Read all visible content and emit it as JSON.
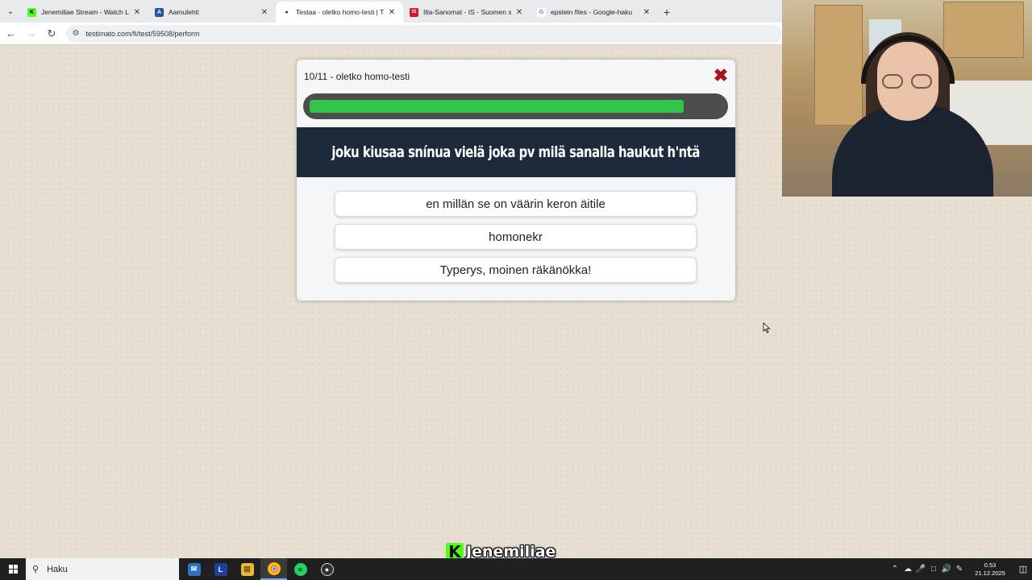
{
  "browser": {
    "tabs": [
      {
        "title": "Jenemiliae Stream - Watch Live",
        "favicon": "kick-icon",
        "color": "#53fc18",
        "active": false
      },
      {
        "title": "Aamulehti",
        "favicon": "aamulehti-icon",
        "color": "#2a4fa3",
        "active": false
      },
      {
        "title": "Testaa - oletko homo-testi | Tes",
        "favicon": "testimato-icon",
        "color": "#333333",
        "active": true
      },
      {
        "title": "Ilta-Sanomat - IS - Suomen suu",
        "favicon": "is-icon",
        "color": "#d3192b",
        "active": false
      },
      {
        "title": "epstein files - Google-haku",
        "favicon": "google-icon",
        "color": "#4285f4",
        "active": false
      }
    ],
    "url": "testimato.com/fi/test/59508/perform"
  },
  "quiz": {
    "title": "10/11 - oletko homo-testi",
    "progress": 0.909,
    "question": "joku kiusaa snínua vielä joka pv milä sanalla haukut h'ntä",
    "answers": [
      "en millän se on väärin keron äitile",
      "homonekr",
      "Typerys, moinen räkänökka!"
    ],
    "colors": {
      "progress": "#34c44a",
      "question_bg": "#1c2a3c",
      "close": "#a8141c"
    }
  },
  "watermark": {
    "name": "Jenemiliae",
    "logo": "K"
  },
  "taskbar": {
    "search_placeholder": "Haku",
    "apps": [
      "mail-app-icon",
      "l-app-icon",
      "file-explorer-icon",
      "chrome-icon",
      "spotify-icon",
      "obs-icon"
    ],
    "time": "0.53",
    "date": "21.12.2025"
  }
}
